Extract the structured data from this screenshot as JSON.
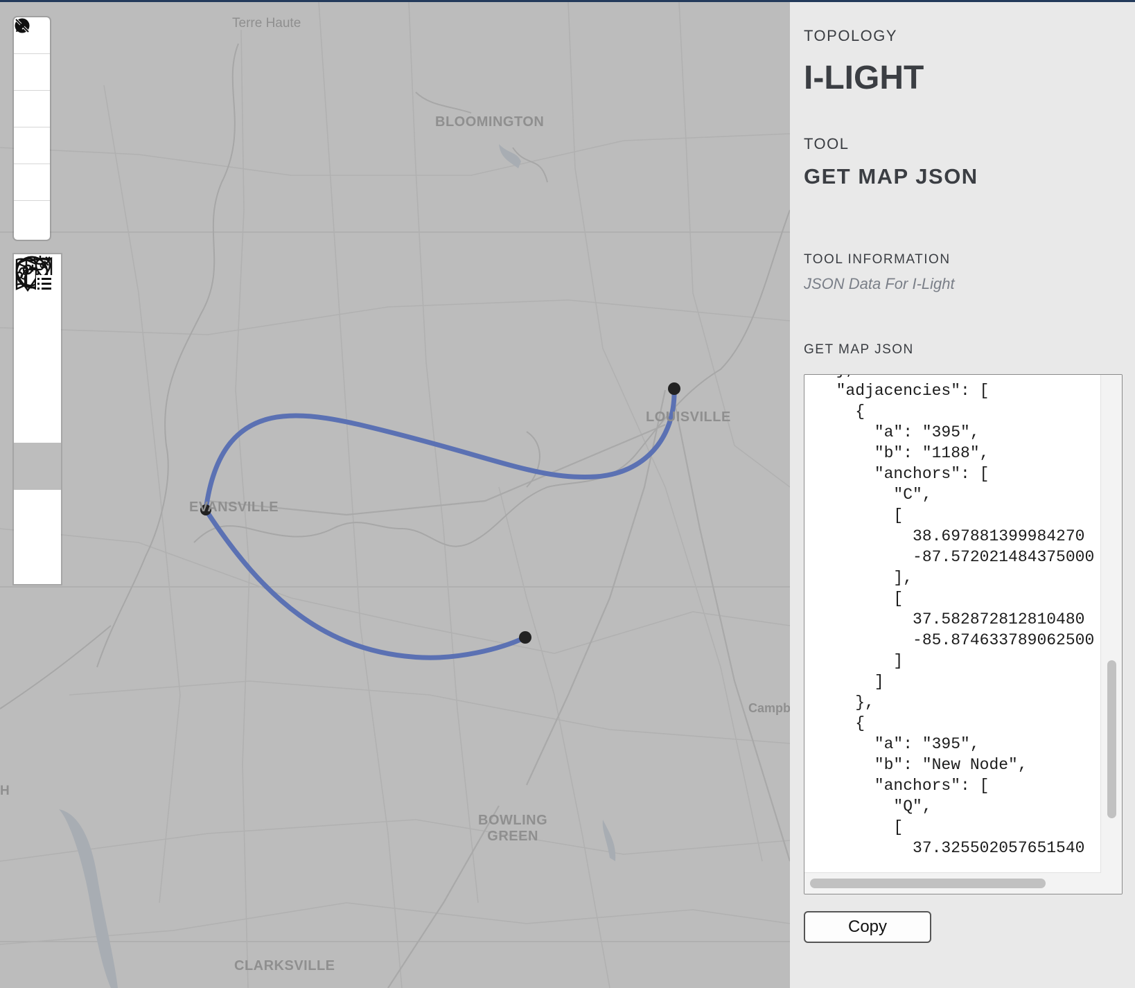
{
  "map": {
    "cities": [
      {
        "id": "bloomington",
        "name": "BLOOMINGTON"
      },
      {
        "id": "louisville",
        "name": "LOUISVILLE"
      },
      {
        "id": "evansville",
        "name": "EVANSVILLE"
      },
      {
        "id": "bowling-green",
        "name": "BOWLING\nGREEN"
      },
      {
        "id": "clarksville",
        "name": "CLARKSVILLE"
      }
    ],
    "towns": [
      {
        "id": "terre-haute",
        "name": "Terre Haute"
      },
      {
        "id": "campbellsville",
        "name": "Campb"
      },
      {
        "id": "edge-h",
        "name": "H"
      }
    ],
    "link_color": "#5b71b3",
    "node_color": "#222222"
  },
  "toolbar": {
    "buttons": [
      {
        "name": "zoom-in",
        "icon": "plus-icon"
      },
      {
        "name": "zoom-out",
        "icon": "minus-icon"
      },
      {
        "name": "globe",
        "icon": "globe-icon"
      },
      {
        "name": "layers",
        "icon": "layers-icon"
      },
      {
        "name": "layers-off",
        "icon": "layers-off-icon"
      },
      {
        "name": "edit",
        "icon": "pencil-icon"
      }
    ]
  },
  "tools": {
    "buttons": [
      {
        "name": "add-node",
        "icon": "add-pin-icon",
        "active": false
      },
      {
        "name": "add-link",
        "icon": "add-link-icon",
        "active": false
      },
      {
        "name": "node-map",
        "icon": "map-pin-icon",
        "active": false
      },
      {
        "name": "link-map",
        "icon": "map-route-icon",
        "active": false
      },
      {
        "name": "get-map-json",
        "icon": "globe-download-icon",
        "active": true
      },
      {
        "name": "add-topology",
        "icon": "globe-add-icon",
        "active": false
      },
      {
        "name": "topology-list",
        "icon": "globe-list-icon",
        "active": false
      }
    ]
  },
  "panel": {
    "topology_label": "TOPOLOGY",
    "topology_name": "I-LIGHT",
    "tool_label": "TOOL",
    "tool_name": "GET MAP JSON",
    "tool_info_label": "TOOL INFORMATION",
    "tool_info": "JSON Data For I-Light",
    "json_label": "GET MAP JSON",
    "json_text": "  },\n  \"adjacencies\": [\n    {\n      \"a\": \"395\",\n      \"b\": \"1188\",\n      \"anchors\": [\n        \"C\",\n        [\n          38.697881399984270\n          -87.572021484375000\n        ],\n        [\n          37.582872812810480\n          -85.874633789062500\n        ]\n      ]\n    },\n    {\n      \"a\": \"395\",\n      \"b\": \"New Node\",\n      \"anchors\": [\n        \"Q\",\n        [\n          37.325502057651540",
    "copy_label": "Copy"
  }
}
